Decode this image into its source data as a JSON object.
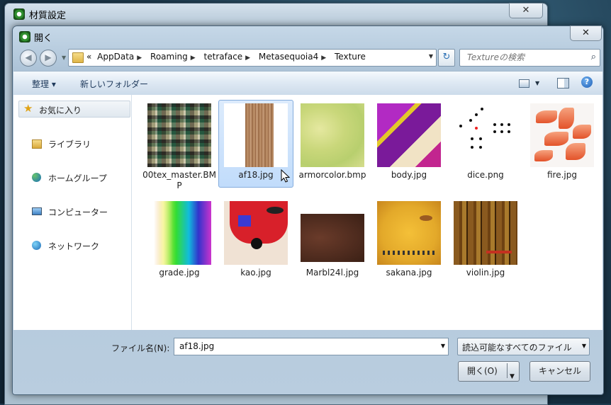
{
  "parent_window": {
    "title": "材質設定",
    "close_label": "✕"
  },
  "dialog": {
    "title": "開く",
    "close_label": "✕"
  },
  "nav": {
    "back_label": "◀",
    "forward_label": "▶",
    "breadcrumb": [
      "AppData",
      "Roaming",
      "tetraface",
      "Metasequoia4",
      "Texture"
    ],
    "overflow": "«",
    "refresh_label": "↻",
    "search_placeholder": "Textureの検索"
  },
  "toolbar": {
    "organize": "整理 ▾",
    "new_folder": "新しいフォルダー",
    "help": "?"
  },
  "sidebar": {
    "favorites": "お気に入り",
    "items": [
      {
        "label": "ライブラリ",
        "icon": "library-icon"
      },
      {
        "label": "ホームグループ",
        "icon": "homegroup-icon"
      },
      {
        "label": "コンピューター",
        "icon": "computer-icon"
      },
      {
        "label": "ネットワーク",
        "icon": "network-icon"
      }
    ]
  },
  "files": [
    {
      "name": "00tex_master.BMP",
      "selected": false
    },
    {
      "name": "af18.jpg",
      "selected": true
    },
    {
      "name": "armorcolor.bmp",
      "selected": false
    },
    {
      "name": "body.jpg",
      "selected": false
    },
    {
      "name": "dice.png",
      "selected": false
    },
    {
      "name": "fire.jpg",
      "selected": false
    },
    {
      "name": "grade.jpg",
      "selected": false
    },
    {
      "name": "kao.jpg",
      "selected": false
    },
    {
      "name": "Marbl24l.jpg",
      "selected": false
    },
    {
      "name": "sakana.jpg",
      "selected": false
    },
    {
      "name": "violin.jpg",
      "selected": false
    }
  ],
  "footer": {
    "filename_label": "ファイル名(N):",
    "filename_value": "af18.jpg",
    "filter_value": "読込可能なすべてのファイル",
    "open_label": "開く(O)",
    "cancel_label": "キャンセル"
  }
}
